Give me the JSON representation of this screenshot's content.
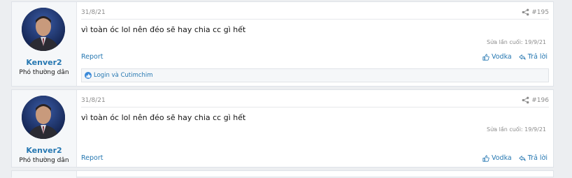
{
  "posts": [
    {
      "date": "31/8/21",
      "number": "#195",
      "username": "Kenver2",
      "user_title": "Phó thường dân",
      "content": "vì toàn óc lol nên đéo sẽ hay chia cc gì hết",
      "edited": "Sửa lần cuối: 19/9/21",
      "report_label": "Report",
      "reaction_label": "Vodka",
      "reply_label": "Trả lời",
      "reactions_text": "Login và Cutimchim"
    },
    {
      "date": "31/8/21",
      "number": "#196",
      "username": "Kenver2",
      "user_title": "Phó thường dân",
      "content": "vì toàn óc lol nên đéo sẽ hay chia cc gì hết",
      "edited": "Sửa lần cuối: 19/9/21",
      "report_label": "Report",
      "reaction_label": "Vodka",
      "reply_label": "Trả lời"
    }
  ],
  "colors": {
    "link": "#2577b1",
    "muted": "#8c8c8c",
    "background": "#eceef1"
  }
}
